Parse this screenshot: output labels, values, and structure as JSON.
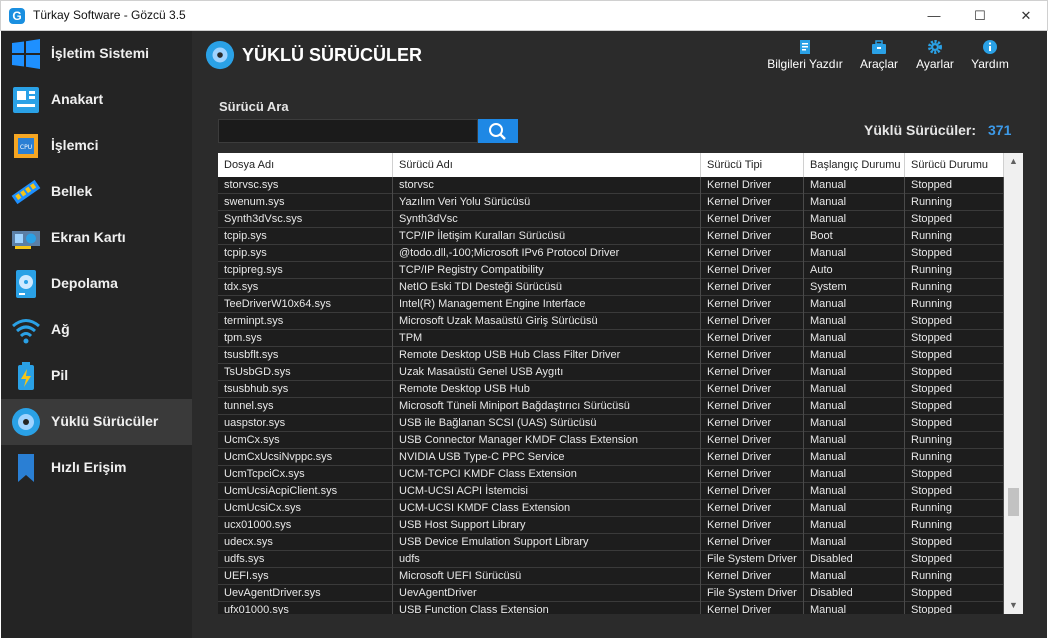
{
  "window": {
    "title": "Türkay Software - Gözcü 3.5",
    "app_icon_letter": "G",
    "minimize_glyph": "—",
    "maximize_glyph": "☐",
    "close_glyph": "✕"
  },
  "sidebar": {
    "items": [
      {
        "label": "İşletim Sistemi",
        "icon": "windows-icon",
        "active": false
      },
      {
        "label": "Anakart",
        "icon": "motherboard-icon",
        "active": false
      },
      {
        "label": "İşlemci",
        "icon": "cpu-icon",
        "active": false
      },
      {
        "label": "Bellek",
        "icon": "memory-icon",
        "active": false
      },
      {
        "label": "Ekran Kartı",
        "icon": "graphics-card-icon",
        "active": false
      },
      {
        "label": "Depolama",
        "icon": "storage-icon",
        "active": false
      },
      {
        "label": "Ağ",
        "icon": "wifi-icon",
        "active": false
      },
      {
        "label": "Pil",
        "icon": "battery-icon",
        "active": false
      },
      {
        "label": "Yüklü Sürücüler",
        "icon": "disc-icon",
        "active": true
      },
      {
        "label": "Hızlı Erişim",
        "icon": "bookmark-icon",
        "active": false
      }
    ]
  },
  "header": {
    "title": "YÜKLÜ SÜRÜCÜLER",
    "tools": [
      {
        "label": "Bilgileri Yazdır",
        "icon": "print-icon"
      },
      {
        "label": "Araçlar",
        "icon": "toolbox-icon"
      },
      {
        "label": "Ayarlar",
        "icon": "gear-icon"
      },
      {
        "label": "Yardım",
        "icon": "info-icon"
      }
    ]
  },
  "search": {
    "label": "Sürücü Ara",
    "value": "",
    "placeholder": ""
  },
  "count": {
    "label": "Yüklü Sürücüler:",
    "value": "371"
  },
  "table": {
    "columns": [
      "Dosya Adı",
      "Sürücü Adı",
      "Sürücü Tipi",
      "Başlangıç Durumu",
      "Sürücü Durumu"
    ],
    "rows": [
      [
        "storvsc.sys",
        "storvsc",
        "Kernel Driver",
        "Manual",
        "Stopped"
      ],
      [
        "swenum.sys",
        "Yazılım Veri Yolu Sürücüsü",
        "Kernel Driver",
        "Manual",
        "Running"
      ],
      [
        "Synth3dVsc.sys",
        "Synth3dVsc",
        "Kernel Driver",
        "Manual",
        "Stopped"
      ],
      [
        "tcpip.sys",
        "TCP/IP İletişim Kuralları Sürücüsü",
        "Kernel Driver",
        "Boot",
        "Running"
      ],
      [
        "tcpip.sys",
        "@todo.dll,-100;Microsoft IPv6 Protocol Driver",
        "Kernel Driver",
        "Manual",
        "Stopped"
      ],
      [
        "tcpipreg.sys",
        "TCP/IP Registry Compatibility",
        "Kernel Driver",
        "Auto",
        "Running"
      ],
      [
        "tdx.sys",
        "NetIO Eski TDI Desteği Sürücüsü",
        "Kernel Driver",
        "System",
        "Running"
      ],
      [
        "TeeDriverW10x64.sys",
        "Intel(R) Management Engine Interface",
        "Kernel Driver",
        "Manual",
        "Running"
      ],
      [
        "terminpt.sys",
        "Microsoft Uzak Masaüstü Giriş Sürücüsü",
        "Kernel Driver",
        "Manual",
        "Stopped"
      ],
      [
        "tpm.sys",
        "TPM",
        "Kernel Driver",
        "Manual",
        "Stopped"
      ],
      [
        "tsusbflt.sys",
        "Remote Desktop USB Hub Class Filter Driver",
        "Kernel Driver",
        "Manual",
        "Stopped"
      ],
      [
        "TsUsbGD.sys",
        "Uzak Masaüstü Genel USB Aygıtı",
        "Kernel Driver",
        "Manual",
        "Stopped"
      ],
      [
        "tsusbhub.sys",
        "Remote Desktop USB Hub",
        "Kernel Driver",
        "Manual",
        "Stopped"
      ],
      [
        "tunnel.sys",
        "Microsoft Tüneli Miniport Bağdaştırıcı Sürücüsü",
        "Kernel Driver",
        "Manual",
        "Stopped"
      ],
      [
        "uaspstor.sys",
        "USB ile Bağlanan SCSI (UAS) Sürücüsü",
        "Kernel Driver",
        "Manual",
        "Stopped"
      ],
      [
        "UcmCx.sys",
        "USB Connector Manager KMDF Class Extension",
        "Kernel Driver",
        "Manual",
        "Running"
      ],
      [
        "UcmCxUcsiNvppc.sys",
        "NVIDIA USB Type-C PPC Service",
        "Kernel Driver",
        "Manual",
        "Running"
      ],
      [
        "UcmTcpciCx.sys",
        "UCM-TCPCI KMDF Class Extension",
        "Kernel Driver",
        "Manual",
        "Stopped"
      ],
      [
        "UcmUcsiAcpiClient.sys",
        "UCM-UCSI ACPI İstemcisi",
        "Kernel Driver",
        "Manual",
        "Stopped"
      ],
      [
        "UcmUcsiCx.sys",
        "UCM-UCSI KMDF Class Extension",
        "Kernel Driver",
        "Manual",
        "Running"
      ],
      [
        "ucx01000.sys",
        "USB Host Support Library",
        "Kernel Driver",
        "Manual",
        "Running"
      ],
      [
        "udecx.sys",
        "USB Device Emulation Support Library",
        "Kernel Driver",
        "Manual",
        "Stopped"
      ],
      [
        "udfs.sys",
        "udfs",
        "File System Driver",
        "Disabled",
        "Stopped"
      ],
      [
        "UEFI.sys",
        "Microsoft UEFI Sürücüsü",
        "Kernel Driver",
        "Manual",
        "Running"
      ],
      [
        "UevAgentDriver.sys",
        "UevAgentDriver",
        "File System Driver",
        "Disabled",
        "Stopped"
      ],
      [
        "ufx01000.sys",
        "USB Function Class Extension",
        "Kernel Driver",
        "Manual",
        "Stopped"
      ]
    ]
  },
  "scrollbar": {
    "up_glyph": "▲",
    "down_glyph": "▼"
  },
  "colors": {
    "accent": "#1e88e5",
    "count": "#3d9ae8",
    "background": "#2b2b2b",
    "sidebar": "#242424"
  }
}
